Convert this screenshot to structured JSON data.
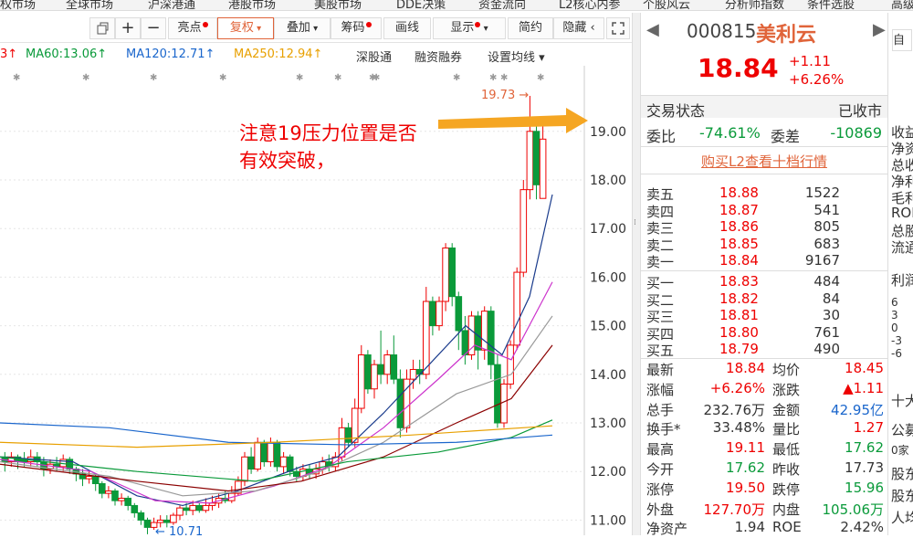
{
  "top_nav": [
    "权市场",
    "全球市场",
    "沪深港通",
    "港股市场",
    "美股市场",
    "DDE决策",
    "资金流向",
    "L2核心内参",
    "个股风云",
    "分析师指数",
    "条件选股",
    "高级"
  ],
  "toolbar": {
    "icons": [
      "restore-icon",
      "plus-icon",
      "minus-icon"
    ],
    "buttons": [
      {
        "label": "亮点",
        "dot": true,
        "active": false
      },
      {
        "label": "复权",
        "dot": false,
        "active": true,
        "dropdown": true
      },
      {
        "label": "叠加",
        "dot": false,
        "active": false,
        "dropdown": true
      },
      {
        "label": "筹码",
        "dot": true,
        "active": false
      },
      {
        "label": "画线",
        "dot": false,
        "active": false
      },
      {
        "label": "显示",
        "dot": true,
        "active": false,
        "dropdown": true
      },
      {
        "label": "简约",
        "dot": false,
        "active": false
      },
      {
        "label": "隐藏",
        "dot": false,
        "active": false,
        "arrow": "‹"
      }
    ]
  },
  "ma_legend": [
    {
      "text": "3↑",
      "color": "#e00"
    },
    {
      "text": "MA60:13.06↑",
      "color": "#0a9a3a"
    },
    {
      "text": "MA120:12.71↑",
      "color": "#1a66cc"
    },
    {
      "text": "MA250:12.94↑",
      "color": "#e8a000"
    }
  ],
  "chart_links": [
    "深股通",
    "融资融券",
    "设置均线"
  ],
  "chart_data": {
    "type": "candlestick",
    "y_ticks": [
      "19.00",
      "18.00",
      "17.00",
      "16.00",
      "15.00",
      "14.00",
      "13.00",
      "12.00",
      "11.00"
    ],
    "ylim": [
      10.8,
      19.8
    ],
    "high_label": "19.73",
    "low_label": "10.71",
    "annotation": "注意19压力位置是否\n有效突破，",
    "up_color": "#e00",
    "down_color": "#0a9a3a"
  },
  "stock": {
    "code": "000815",
    "name": "美利云",
    "price": "18.84",
    "change": "+1.11",
    "change_pct": "+6.26%",
    "status_label": "交易状态",
    "status_value": "已收市",
    "weibi_label": "委比",
    "weibi": "-74.61%",
    "weicha_label": "委差",
    "weicha": "-10869",
    "l2_link": "购买L2查看十档行情"
  },
  "sell_orders": [
    {
      "label": "卖五",
      "price": "18.88",
      "vol": "1522"
    },
    {
      "label": "卖四",
      "price": "18.87",
      "vol": "541"
    },
    {
      "label": "卖三",
      "price": "18.86",
      "vol": "805"
    },
    {
      "label": "卖二",
      "price": "18.85",
      "vol": "683"
    },
    {
      "label": "卖一",
      "price": "18.84",
      "vol": "9167"
    }
  ],
  "buy_orders": [
    {
      "label": "买一",
      "price": "18.83",
      "vol": "484"
    },
    {
      "label": "买二",
      "price": "18.82",
      "vol": "84"
    },
    {
      "label": "买三",
      "price": "18.81",
      "vol": "30"
    },
    {
      "label": "买四",
      "price": "18.80",
      "vol": "761"
    },
    {
      "label": "买五",
      "price": "18.79",
      "vol": "490"
    }
  ],
  "stats": [
    {
      "l1": "最新",
      "v1": "18.84",
      "c1": "red",
      "l2": "均价",
      "v2": "18.45",
      "c2": "red"
    },
    {
      "l1": "涨幅",
      "v1": "+6.26%",
      "c1": "red",
      "l2": "涨跌",
      "v2": "▲1.11",
      "c2": "red"
    },
    {
      "l1": "总手",
      "v1": "232.76万",
      "c1": "",
      "l2": "金额",
      "v2": "42.95亿",
      "c2": "blue"
    },
    {
      "l1": "换手*",
      "v1": "33.48%",
      "c1": "",
      "l2": "量比",
      "v2": "1.27",
      "c2": "red"
    },
    {
      "l1": "最高",
      "v1": "19.11",
      "c1": "red",
      "l2": "最低",
      "v2": "17.62",
      "c2": "green"
    },
    {
      "l1": "今开",
      "v1": "17.62",
      "c1": "green",
      "l2": "昨收",
      "v2": "17.73",
      "c2": ""
    },
    {
      "l1": "涨停",
      "v1": "19.50",
      "c1": "red",
      "l2": "跌停",
      "v2": "15.96",
      "c2": "green"
    },
    {
      "l1": "外盘",
      "v1": "127.70万",
      "c1": "red",
      "l2": "内盘",
      "v2": "105.06万",
      "c2": "green"
    },
    {
      "l1": "净资产",
      "v1": "1.94",
      "c1": "",
      "l2": "ROE",
      "v2": "2.42%",
      "c2": ""
    }
  ],
  "side_fragments": [
    "收益",
    "净资",
    "总收",
    "净利",
    "毛利",
    "ROE",
    "总股",
    "流通",
    "利润",
    "6",
    "3",
    "0",
    "-3",
    "-6",
    "十大",
    "公募",
    "0家",
    "股东",
    "股东",
    "人均"
  ]
}
